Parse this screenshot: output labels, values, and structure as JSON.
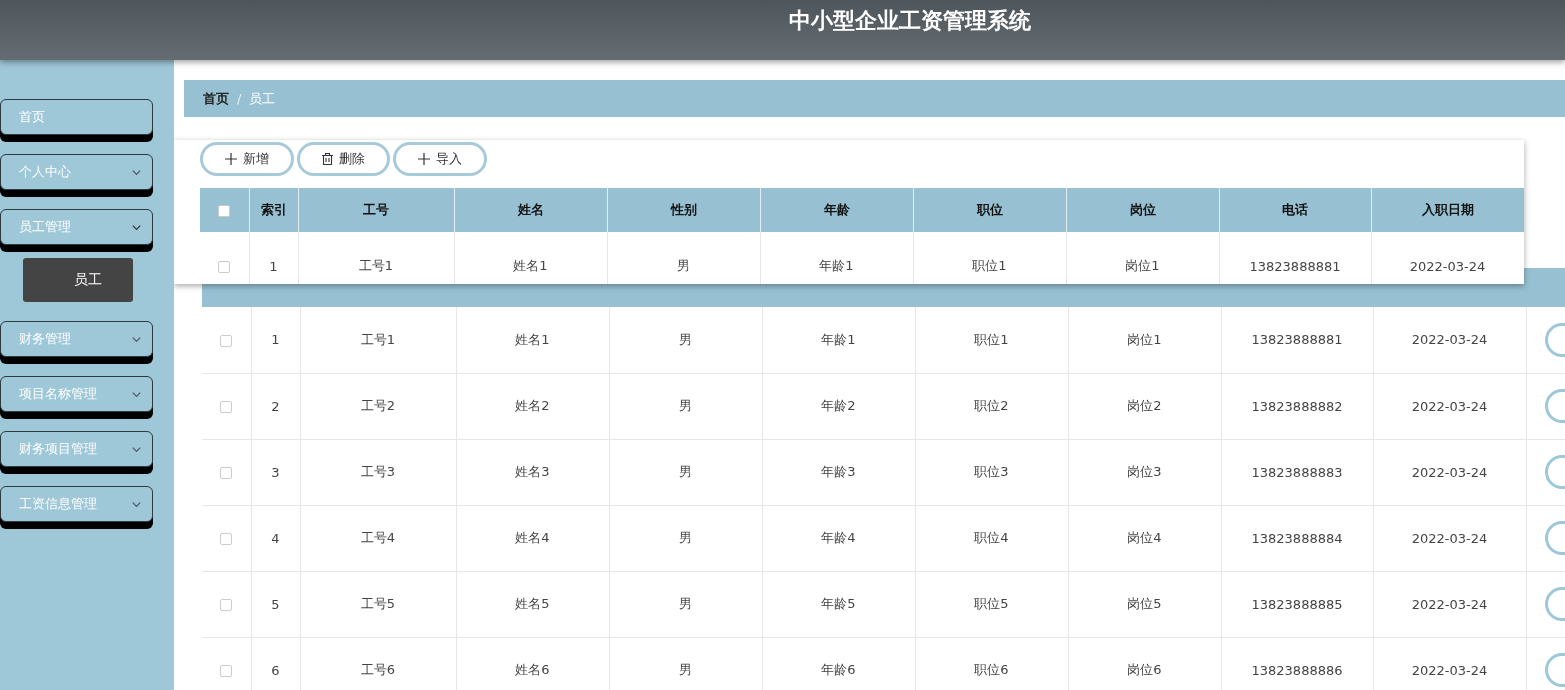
{
  "header": {
    "title": "中小型企业工资管理系统"
  },
  "sidebar": {
    "items": [
      {
        "kind": "link",
        "label": "首页"
      },
      {
        "kind": "menu",
        "label": "个人中心",
        "expanded": false
      },
      {
        "kind": "menu",
        "label": "员工管理",
        "expanded": true,
        "children": [
          {
            "label": "员工",
            "selected": true
          }
        ]
      },
      {
        "kind": "menu",
        "label": "财务管理",
        "expanded": false
      },
      {
        "kind": "menu",
        "label": "项目名称管理",
        "expanded": false
      },
      {
        "kind": "menu",
        "label": "财务项目管理",
        "expanded": false
      },
      {
        "kind": "menu",
        "label": "工资信息管理",
        "expanded": false
      }
    ]
  },
  "breadcrumb": {
    "items": [
      "首页",
      "员工"
    ],
    "separator": "/"
  },
  "floating_panel": {
    "buttons": [
      {
        "kind": "plus",
        "label": "新增"
      },
      {
        "kind": "trash",
        "label": "删除"
      },
      {
        "kind": "plus",
        "label": "导入"
      }
    ],
    "select_all_checked": false,
    "columns": [
      "索引",
      "工号",
      "姓名",
      "性别",
      "年龄",
      "职位",
      "岗位",
      "电话",
      "入职日期"
    ],
    "rows": [
      {
        "checked": false,
        "cells": [
          "1",
          "工号1",
          "姓名1",
          "男",
          "年龄1",
          "职位1",
          "岗位1",
          "13823888881",
          "2022-03-24"
        ]
      }
    ]
  },
  "table": {
    "rows": [
      {
        "checked": false,
        "cells": [
          "1",
          "工号1",
          "姓名1",
          "男",
          "年龄1",
          "职位1",
          "岗位1",
          "13823888881",
          "2022-03-24"
        ]
      },
      {
        "checked": false,
        "cells": [
          "2",
          "工号2",
          "姓名2",
          "男",
          "年龄2",
          "职位2",
          "岗位2",
          "13823888882",
          "2022-03-24"
        ]
      },
      {
        "checked": false,
        "cells": [
          "3",
          "工号3",
          "姓名3",
          "男",
          "年龄3",
          "职位3",
          "岗位3",
          "13823888883",
          "2022-03-24"
        ]
      },
      {
        "checked": false,
        "cells": [
          "4",
          "工号4",
          "姓名4",
          "男",
          "年龄4",
          "职位4",
          "岗位4",
          "13823888884",
          "2022-03-24"
        ]
      },
      {
        "checked": false,
        "cells": [
          "5",
          "工号5",
          "姓名5",
          "男",
          "年龄5",
          "职位5",
          "岗位5",
          "13823888885",
          "2022-03-24"
        ]
      },
      {
        "checked": false,
        "cells": [
          "6",
          "工号6",
          "姓名6",
          "男",
          "年龄6",
          "职位6",
          "岗位6",
          "13823888886",
          "2022-03-24"
        ]
      }
    ]
  }
}
